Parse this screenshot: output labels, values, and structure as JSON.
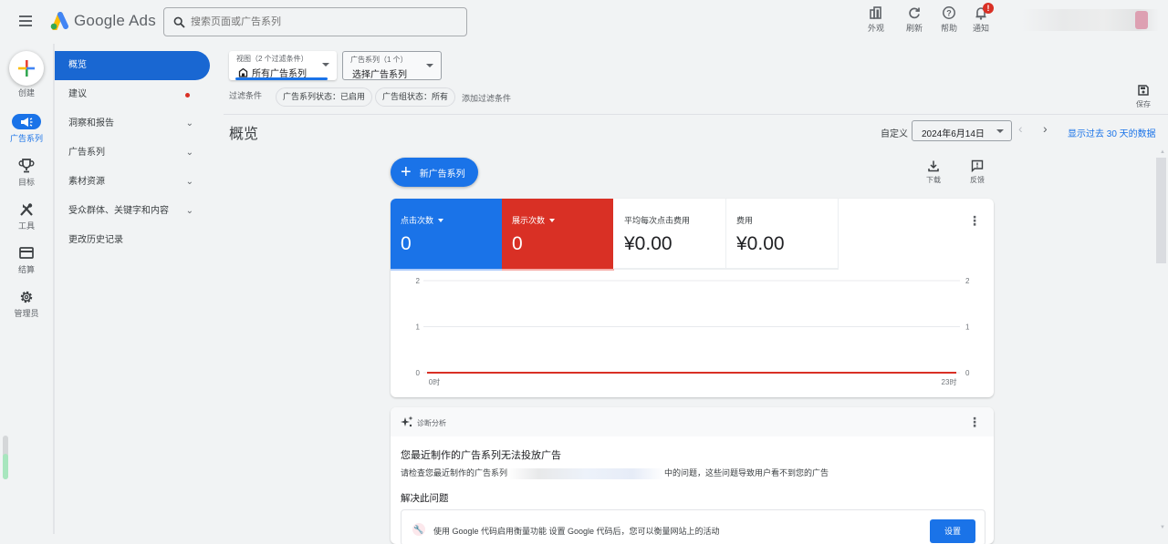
{
  "app": {
    "name": "Google Ads"
  },
  "search": {
    "placeholder": "搜索页面或广告系列"
  },
  "toolbar": [
    {
      "label": "外观",
      "icon": "appearance-icon"
    },
    {
      "label": "刷新",
      "icon": "refresh-icon"
    },
    {
      "label": "帮助",
      "icon": "help-icon"
    },
    {
      "label": "通知",
      "icon": "bell-icon",
      "badge": "!"
    }
  ],
  "rail": {
    "create": "创建",
    "items": [
      {
        "label": "广告系列",
        "icon": "campaign-icon",
        "active": true
      },
      {
        "label": "目标",
        "icon": "trophy-icon"
      },
      {
        "label": "工具",
        "icon": "tools-icon"
      },
      {
        "label": "结算",
        "icon": "billing-icon"
      },
      {
        "label": "管理员",
        "icon": "gear-icon"
      }
    ]
  },
  "nav": {
    "items": [
      {
        "label": "概览",
        "active": true
      },
      {
        "label": "建议",
        "dot": true
      },
      {
        "label": "洞察和报告",
        "expandable": true
      },
      {
        "label": "广告系列",
        "expandable": true
      },
      {
        "label": "素材资源",
        "expandable": true
      },
      {
        "label": "受众群体、关键字和内容",
        "expandable": true
      },
      {
        "label": "更改历史记录"
      }
    ]
  },
  "filters": {
    "view_small": "视图（2 个过滤条件）",
    "view_main": "所有广告系列",
    "campaign_small": "广告系列（1 个）",
    "campaign_main": "选择广告系列",
    "label": "过滤条件",
    "chips": [
      "广告系列状态：已启用",
      "广告组状态：所有"
    ],
    "add": "添加过滤条件",
    "save": "保存"
  },
  "page": {
    "title": "概览",
    "date_label": "自定义",
    "date_value": "2024年6月14日",
    "last_30": "显示过去 30 天的数据"
  },
  "actions": {
    "new_campaign": "新广告系列",
    "download": "下载",
    "feedback": "反馈"
  },
  "metrics": [
    {
      "label": "点击次数",
      "value": "0",
      "dropdown": true,
      "color": "#1a73e8"
    },
    {
      "label": "展示次数",
      "value": "0",
      "dropdown": true,
      "color": "#d93025"
    },
    {
      "label": "平均每次点击费用",
      "value": "¥0.00"
    },
    {
      "label": "费用",
      "value": "¥0.00"
    }
  ],
  "chart_data": {
    "type": "line",
    "title": "",
    "x": [
      "0时",
      "23时"
    ],
    "xlabel": "",
    "ylabel": "",
    "ylim": [
      0,
      2
    ],
    "y_ticks": [
      "0",
      "1",
      "2"
    ],
    "y2_ticks": [
      "0",
      "1",
      "2"
    ],
    "grid": true,
    "series": [
      {
        "name": "点击次数",
        "color": "#1a73e8",
        "values": [
          0,
          0
        ]
      },
      {
        "name": "展示次数",
        "color": "#d93025",
        "values": [
          0,
          0
        ]
      }
    ]
  },
  "diagnostics": {
    "title": "诊断分析",
    "headline": "您最近制作的广告系列无法投放广告",
    "body_before": "请检查您最近制作的广告系列",
    "body_after": "中的问题，这些问题导致用户看不到您的广告",
    "resolve_heading": "解决此问题",
    "fix_text": "使用 Google 代码启用衡量功能  设置 Google 代码后，您可以衡量网站上的活动",
    "fix_button": "设置"
  }
}
